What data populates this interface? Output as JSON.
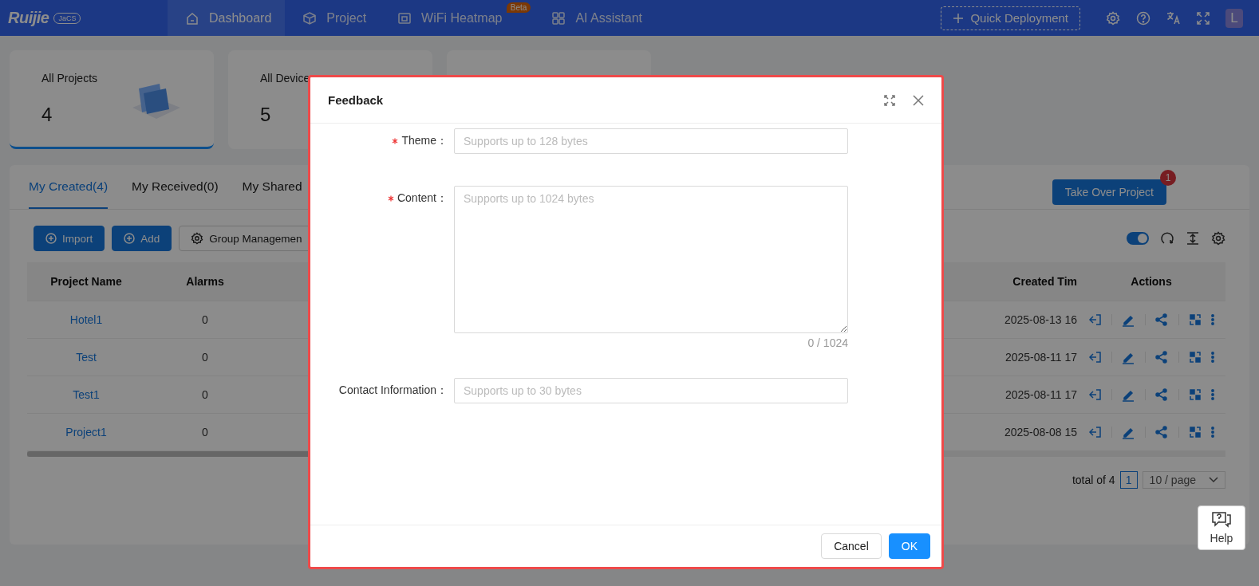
{
  "header": {
    "logo": "Ruijie",
    "logo_badge": "JaCS",
    "nav": [
      {
        "label": "Dashboard",
        "selected": true
      },
      {
        "label": "Project",
        "selected": false
      },
      {
        "label": "WiFi Heatmap",
        "selected": false,
        "badge": "Beta"
      },
      {
        "label": "AI Assistant",
        "selected": false
      }
    ],
    "quick_deploy": "Quick Deployment",
    "avatar": "L"
  },
  "stats": [
    {
      "label": "All Projects",
      "value": "4",
      "selected": true
    },
    {
      "label": "All Device",
      "value": "5",
      "selected": false
    }
  ],
  "projects": {
    "tabs": [
      {
        "label": "My Created(4)",
        "selected": true
      },
      {
        "label": "My Received(0)",
        "selected": false
      },
      {
        "label": "My Shared",
        "selected": false
      }
    ],
    "take_over": {
      "label": "Take Over Project",
      "badge": "1"
    },
    "buttons": [
      {
        "label": "Import",
        "kind": "primary"
      },
      {
        "label": "Add",
        "kind": "primary"
      },
      {
        "label": "Group Managemen",
        "kind": "default"
      }
    ],
    "auto_refresh": {
      "on": true
    },
    "columns": [
      "Project Name",
      "Alarms",
      "Created Tim",
      "Actions"
    ],
    "rows": [
      {
        "name": "Hotel1",
        "alarms": "0",
        "created": "2025-08-13 16"
      },
      {
        "name": "Test",
        "alarms": "0",
        "created": "2025-08-11 17"
      },
      {
        "name": "Test1",
        "alarms": "0",
        "created": "2025-08-11 17"
      },
      {
        "name": "Project1",
        "alarms": "0",
        "created": "2025-08-08 15"
      }
    ],
    "pagination": {
      "total": "total of 4",
      "page": "1",
      "page_size": "10 / page"
    }
  },
  "help": "Help",
  "dialog": {
    "title": "Feedback",
    "fields": [
      {
        "label": "Theme：",
        "required": true,
        "kind": "input",
        "placeholder": "Supports up to 128 bytes"
      },
      {
        "label": "Content：",
        "required": true,
        "kind": "textarea",
        "placeholder": "Supports up to 1024 bytes",
        "counter": "0 / 1024"
      },
      {
        "label": "Contact Information：",
        "required": false,
        "kind": "input",
        "placeholder": "Supports up to 30 bytes"
      }
    ],
    "buttons": [
      {
        "label": "Cancel",
        "kind": "default"
      },
      {
        "label": "OK",
        "kind": "primary"
      }
    ]
  }
}
